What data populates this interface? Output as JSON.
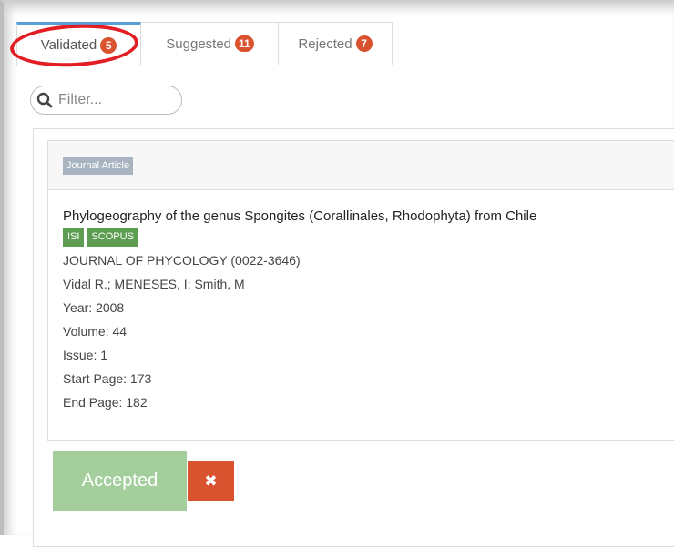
{
  "tabs": [
    {
      "label": "Validated",
      "count": "5",
      "active": true
    },
    {
      "label": "Suggested",
      "count": "11",
      "active": false
    },
    {
      "label": "Rejected",
      "count": "7",
      "active": false
    }
  ],
  "filter": {
    "placeholder": "Filter...",
    "icon": "search-icon"
  },
  "publication": {
    "type": "Journal Article",
    "title": "Phylogeography of the genus Spongites (Corallinales, Rhodophyta) from Chile",
    "tags": [
      "ISI",
      "SCOPUS"
    ],
    "journal": "JOURNAL OF PHYCOLOGY (0022-3646)",
    "authors": "Vidal R.; MENESES, I; Smith, M",
    "year": "Year: 2008",
    "volume": "Volume: 44",
    "issue": "Issue: 1",
    "start_page": "Start Page: 173",
    "end_page": "End Page: 182"
  },
  "actions": {
    "accepted_label": "Accepted",
    "reject_icon": "close-icon",
    "reject_symbol": "✖"
  },
  "colors": {
    "badge": "#d9532f",
    "tag": "#5d9e52",
    "accepted": "#a4cf9c",
    "reject": "#d9532f",
    "annotation": "#e21d24",
    "active_tab": "#5aa0d6"
  }
}
